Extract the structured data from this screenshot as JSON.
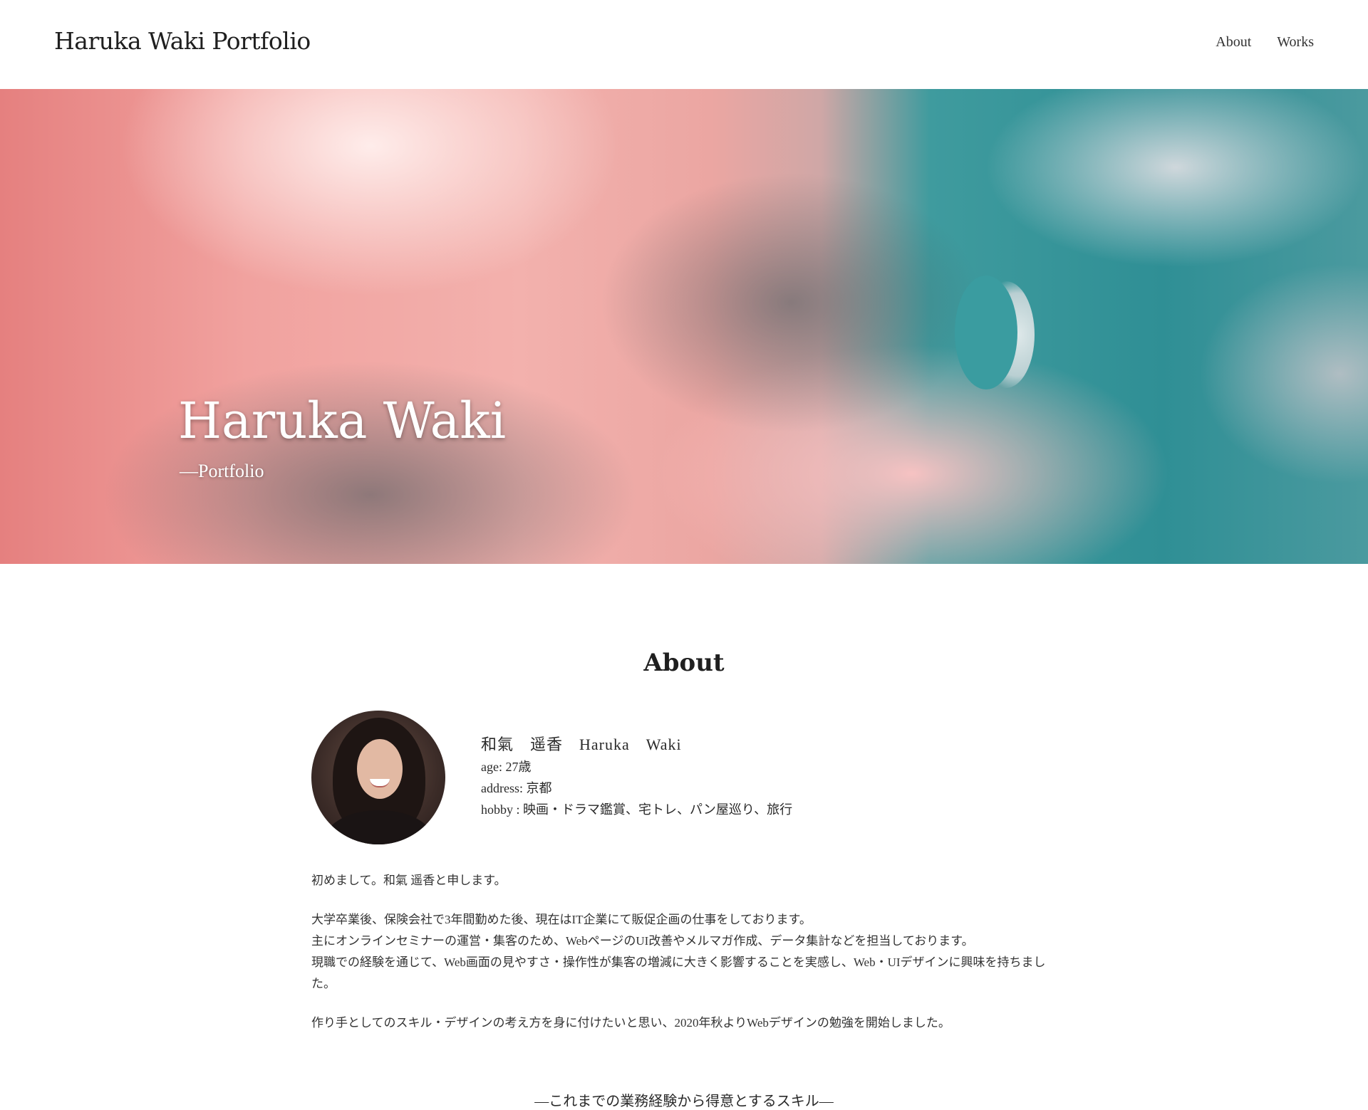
{
  "header": {
    "site_title": "Haruka Waki Portfolio",
    "nav": [
      "About",
      "Works"
    ]
  },
  "hero": {
    "title": "Haruka Waki",
    "subtitle": "—Portfolio"
  },
  "about": {
    "heading": "About",
    "name": "和氣　遥香　Haruka　Waki",
    "age": "age: 27歳",
    "address": "address: 京都",
    "hobby": "hobby : 映画・ドラマ鑑賞、宅トレ、パン屋巡り、旅行",
    "intro_p1": "初めまして。和氣 遥香と申します。",
    "intro_p2_l1": "大学卒業後、保険会社で3年間勤めた後、現在はIT企業にて販促企画の仕事をしております。",
    "intro_p2_l2": "主にオンラインセミナーの運営・集客のため、WebページのUI改善やメルマガ作成、データ集計などを担当しております。",
    "intro_p2_l3": "現職での経験を通じて、Web画面の見やすさ・操作性が集客の増減に大きく影響することを実感し、Web・UIデザインに興味を持ちました。",
    "intro_p3": "作り手としてのスキル・デザインの考え方を身に付けたいと思い、2020年秋よりWebデザインの勉強を開始しました。",
    "skills_heading": "—これまでの業務経験から得意とするスキル—"
  }
}
